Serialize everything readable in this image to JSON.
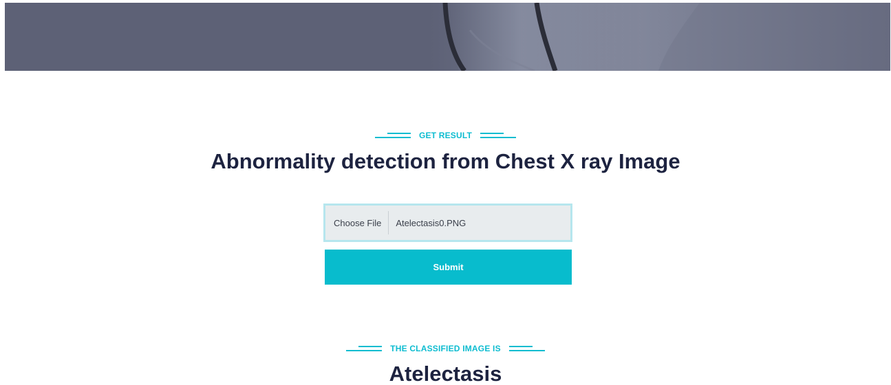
{
  "get_result_section": {
    "tag": "GET RESULT",
    "title": "Abnormality detection from Chest X ray Image"
  },
  "upload_form": {
    "choose_file_label": "Choose File",
    "file_name": "Atelectasis0.PNG",
    "submit_label": "Submit"
  },
  "result_section": {
    "tag": "THE CLASSIFIED IMAGE IS",
    "result": "Atelectasis"
  },
  "colors": {
    "accent": "#08bccd",
    "heading": "#1d2340",
    "hero_overlay": "#5d6176"
  }
}
